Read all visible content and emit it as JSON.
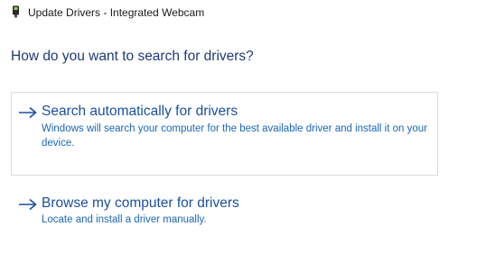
{
  "window": {
    "title": "Update Drivers - Integrated Webcam",
    "icon": "device-driver-icon"
  },
  "heading": "How do you want to search for drivers?",
  "options": [
    {
      "title": "Search automatically for drivers",
      "description": "Windows will search your computer for the best available driver and install it on your device.",
      "icon": "arrow-right-icon",
      "selected": true
    },
    {
      "title": "Browse my computer for drivers",
      "description": "Locate and install a driver manually.",
      "icon": "arrow-right-icon",
      "selected": false
    }
  ],
  "colors": {
    "heading": "#1f3a78",
    "option_title": "#1a4f9e",
    "option_description": "#1a66b8",
    "selection_border": "#dcdcdc"
  }
}
